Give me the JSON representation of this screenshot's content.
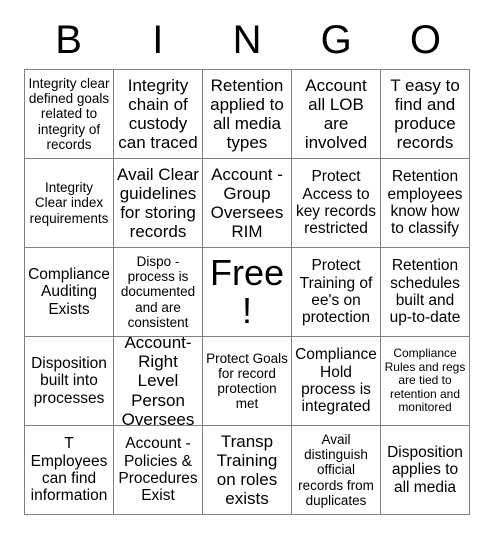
{
  "card": {
    "header_letters": [
      "B",
      "I",
      "N",
      "G",
      "O"
    ],
    "rows": [
      [
        {
          "text": "Integrity clear defined goals related to integrity of records",
          "size": "sm"
        },
        {
          "text": "Integrity chain of custody can traced",
          "size": "lg"
        },
        {
          "text": "Retention applied to all media types",
          "size": "lg"
        },
        {
          "text": "Account all LOB are involved",
          "size": "lg"
        },
        {
          "text": "T easy to find and produce records",
          "size": "lg"
        }
      ],
      [
        {
          "text": "Integrity Clear index requirements",
          "size": "sm"
        },
        {
          "text": "Avail Clear guidelines for storing records",
          "size": "lg"
        },
        {
          "text": "Account - Group Oversees RIM",
          "size": "lg"
        },
        {
          "text": "Protect Access to key records restricted",
          "size": "md"
        },
        {
          "text": "Retention employees know how to classify",
          "size": "md"
        }
      ],
      [
        {
          "text": "Compliance Auditing Exists",
          "size": "md"
        },
        {
          "text": "Dispo - process is documented and are consistent",
          "size": "sm"
        },
        {
          "text": "Free!",
          "size": "xl"
        },
        {
          "text": "Protect Training of ee's on protection",
          "size": "md"
        },
        {
          "text": "Retention schedules built and up-to-date",
          "size": "md"
        }
      ],
      [
        {
          "text": "Disposition built into processes",
          "size": "md"
        },
        {
          "text": "Account- Right Level Person Oversees",
          "size": "lg"
        },
        {
          "text": "Protect Goals for record protection met",
          "size": "sm"
        },
        {
          "text": "Compliance Hold process is integrated",
          "size": "md"
        },
        {
          "text": "Compliance Rules and regs are tied to retention and monitored",
          "size": "xs"
        }
      ],
      [
        {
          "text": "T Employees can find information",
          "size": "md"
        },
        {
          "text": "Account - Policies & Procedures Exist",
          "size": "md"
        },
        {
          "text": "Transp Training on roles exists",
          "size": "lg"
        },
        {
          "text": "Avail distinguish official records from duplicates",
          "size": "sm"
        },
        {
          "text": "Disposition applies to all media",
          "size": "md"
        }
      ]
    ]
  }
}
